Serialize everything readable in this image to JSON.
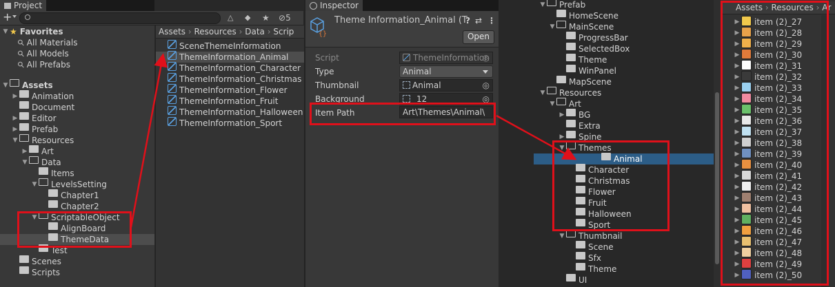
{
  "project_panel": {
    "tab": "Project",
    "add_label": "+",
    "hidden_count": "5",
    "favorites": {
      "title": "Favorites",
      "items": [
        "All Materials",
        "All Models",
        "All Prefabs"
      ]
    },
    "assets_tree": [
      {
        "label": "Assets",
        "depth": 0,
        "open": true,
        "bold": true
      },
      {
        "label": "Animation",
        "depth": 1
      },
      {
        "label": "Document",
        "depth": 1
      },
      {
        "label": "Editor",
        "depth": 1
      },
      {
        "label": "Prefab",
        "depth": 1
      },
      {
        "label": "Resources",
        "depth": 1,
        "open": true
      },
      {
        "label": "Art",
        "depth": 2
      },
      {
        "label": "Data",
        "depth": 2,
        "open": true
      },
      {
        "label": "Items",
        "depth": 3
      },
      {
        "label": "LevelsSetting",
        "depth": 3,
        "open": true
      },
      {
        "label": "Chapter1",
        "depth": 4
      },
      {
        "label": "Chapter2",
        "depth": 4
      },
      {
        "label": "ScriptableObject",
        "depth": 3,
        "open": true
      },
      {
        "label": "AlignBoard",
        "depth": 4
      },
      {
        "label": "ThemeData",
        "depth": 4,
        "selected": true
      },
      {
        "label": "Test",
        "depth": 3
      },
      {
        "label": "Scenes",
        "depth": 1
      },
      {
        "label": "Scripts",
        "depth": 1
      }
    ],
    "breadcrumb": [
      "Assets",
      "Resources",
      "Data",
      "Scrip"
    ],
    "files": [
      {
        "label": "SceneThemeInformation",
        "kind": "script"
      },
      {
        "label": "ThemeInformation_Animal",
        "kind": "asset",
        "selected": true
      },
      {
        "label": "ThemeInformation_Character",
        "kind": "asset"
      },
      {
        "label": "ThemeInformation_Christmas",
        "kind": "asset"
      },
      {
        "label": "ThemeInformation_Flower",
        "kind": "asset"
      },
      {
        "label": "ThemeInformation_Fruit",
        "kind": "asset"
      },
      {
        "label": "ThemeInformation_Halloween",
        "kind": "asset"
      },
      {
        "label": "ThemeInformation_Sport",
        "kind": "asset"
      }
    ]
  },
  "inspector": {
    "tab": "Inspector",
    "title": "Theme Information_Animal (T",
    "open_button": "Open",
    "fields": {
      "script_label": "Script",
      "script_value": "ThemeInformation",
      "type_label": "Type",
      "type_value": "Animal",
      "thumbnail_label": "Thumbnail",
      "thumbnail_value": "Animal",
      "background_label": "Background",
      "background_value": "_12",
      "itempath_label": "Item Path",
      "itempath_value": "Art\\Themes\\Animal\\"
    }
  },
  "hierarchy_tree": [
    {
      "label": "Prefab",
      "depth": 0,
      "open": true
    },
    {
      "label": "HomeScene",
      "depth": 1
    },
    {
      "label": "MainScene",
      "depth": 1,
      "open": true
    },
    {
      "label": "ProgressBar",
      "depth": 2
    },
    {
      "label": "SelectedBox",
      "depth": 2
    },
    {
      "label": "Theme",
      "depth": 2
    },
    {
      "label": "WinPanel",
      "depth": 2
    },
    {
      "label": "MapScene",
      "depth": 1
    },
    {
      "label": "Resources",
      "depth": 0,
      "open": true
    },
    {
      "label": "Art",
      "depth": 1,
      "open": true
    },
    {
      "label": "BG",
      "depth": 2,
      "closed": true
    },
    {
      "label": "Extra",
      "depth": 2
    },
    {
      "label": "Spine",
      "depth": 2,
      "closed": true
    },
    {
      "label": "Themes",
      "depth": 2,
      "open": true
    },
    {
      "label": "Animal",
      "depth": 3,
      "selected": true
    },
    {
      "label": "Character",
      "depth": 3
    },
    {
      "label": "Christmas",
      "depth": 3
    },
    {
      "label": "Flower",
      "depth": 3
    },
    {
      "label": "Fruit",
      "depth": 3
    },
    {
      "label": "Halloween",
      "depth": 3
    },
    {
      "label": "Sport",
      "depth": 3
    },
    {
      "label": "Thumbnail",
      "depth": 2,
      "open": true
    },
    {
      "label": "Scene",
      "depth": 3
    },
    {
      "label": "Sfx",
      "depth": 3
    },
    {
      "label": "Theme",
      "depth": 3
    },
    {
      "label": "UI",
      "depth": 2
    }
  ],
  "right_panel": {
    "breadcrumb": [
      "Assets",
      "Resources",
      "Ar"
    ],
    "items": [
      "item (2)_27",
      "item (2)_28",
      "item (2)_29",
      "item (2)_30",
      "item (2)_31",
      "item (2)_32",
      "item (2)_33",
      "item (2)_34",
      "item (2)_35",
      "item (2)_36",
      "item (2)_37",
      "item (2)_38",
      "item (2)_39",
      "item (2)_40",
      "item (2)_41",
      "item (2)_42",
      "item (2)_43",
      "item (2)_44",
      "item (2)_45",
      "item (2)_46",
      "item (2)_47",
      "item (2)_48",
      "item (2)_49",
      "item (2)_50"
    ],
    "item_colors": [
      "#f2c94c",
      "#e8a24a",
      "#f0b04a",
      "#e07a3a",
      "#ffffff",
      "#3a3a3a",
      "#9ad0f0",
      "#f08aa0",
      "#6ac06a",
      "#e8e8e8",
      "#c0e0f0",
      "#d0d0d0",
      "#7090c0",
      "#e89040",
      "#d8d8d8",
      "#f0f0f0",
      "#a08070",
      "#f0c0a0",
      "#60b060",
      "#f0a040",
      "#e8c070",
      "#f0d0a0",
      "#e04040",
      "#5060c0"
    ]
  },
  "colors": {
    "annotation": "#e0101a",
    "selection_blue": "#2c5d87",
    "accent_blue": "#5aa0e0"
  }
}
